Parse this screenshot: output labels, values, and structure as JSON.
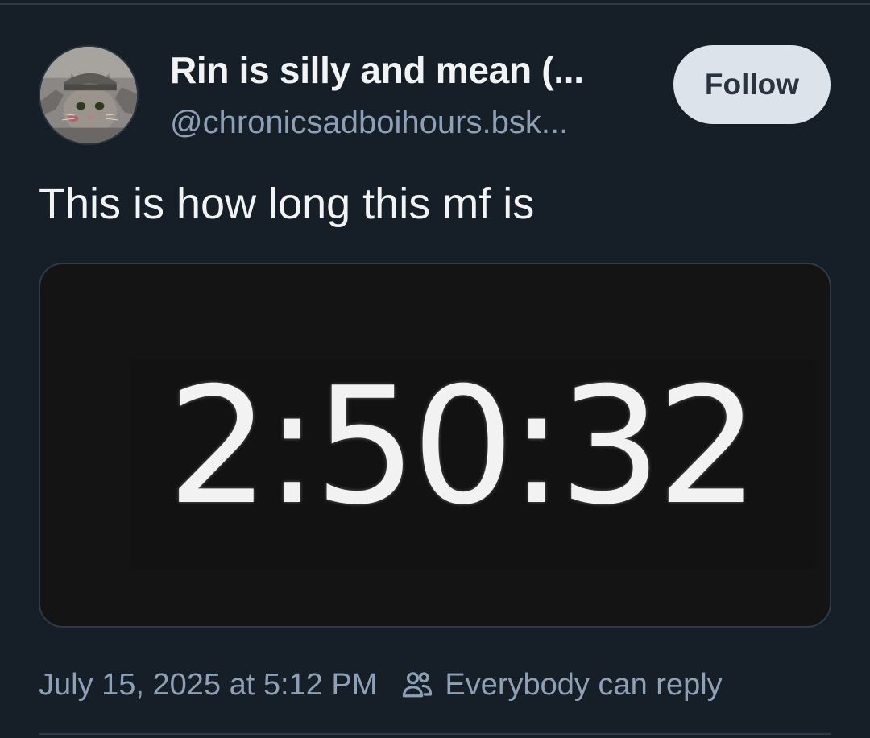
{
  "post": {
    "author": {
      "display_name": "Rin is silly and mean (...",
      "handle": "@chronicsadboihours.bsk..."
    },
    "follow_label": "Follow",
    "text": "This is how long this mf is",
    "media": {
      "timer_text": "2:50:32"
    },
    "timestamp": "July 15, 2025 at 5:12 PM",
    "reply_setting": "Everybody can reply"
  },
  "icons": {
    "avatar": "cat-avatar",
    "reply": "people-icon"
  },
  "colors": {
    "background": "#161e27",
    "text_primary": "#f1f3f5",
    "text_secondary": "#8ea0b5",
    "follow_button_bg": "#dde3ea",
    "follow_button_text": "#2a3440",
    "border": "#2e3a48"
  }
}
